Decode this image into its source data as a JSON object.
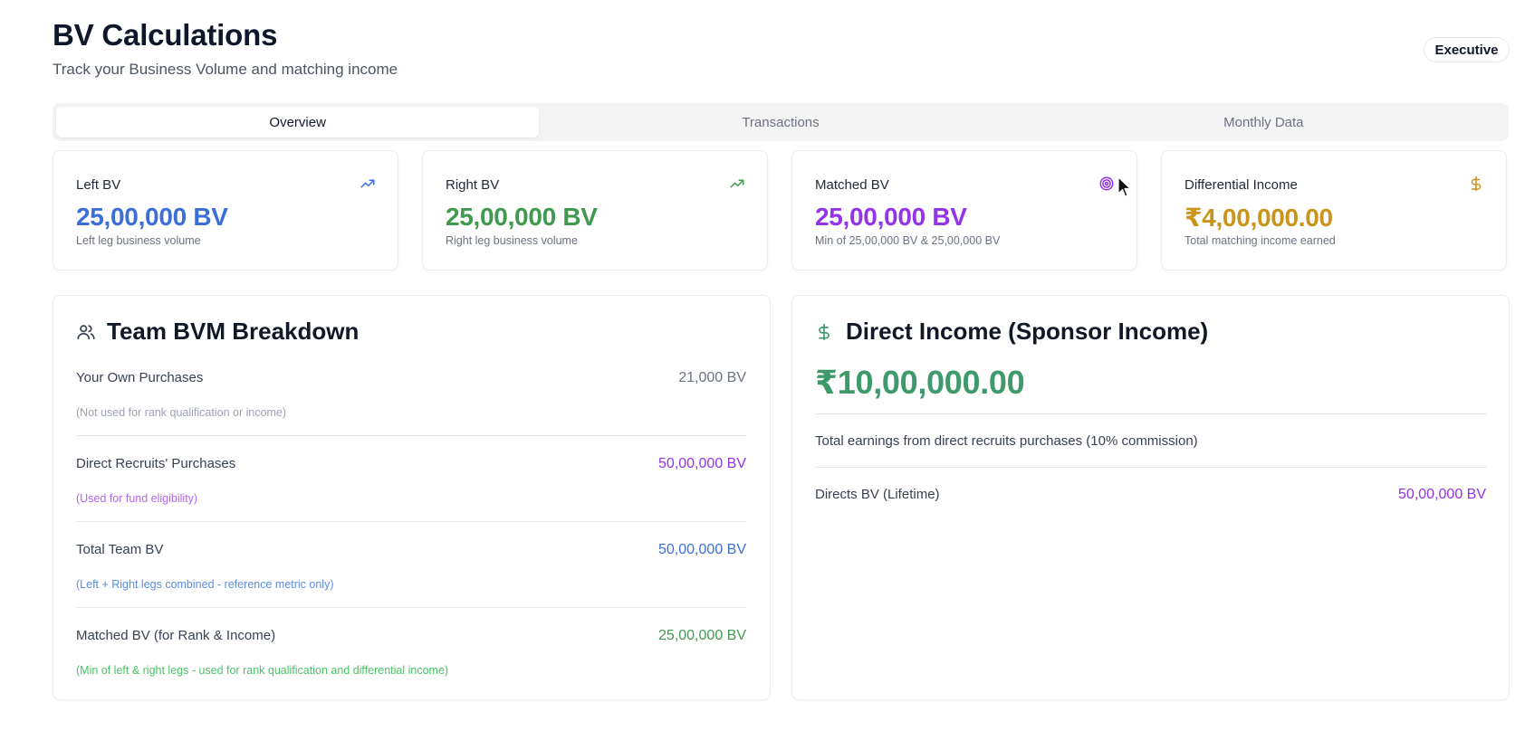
{
  "header": {
    "title": "BV Calculations",
    "subtitle": "Track your Business Volume and matching income",
    "rank_badge": "Executive"
  },
  "tabs": [
    {
      "label": "Overview",
      "active": true
    },
    {
      "label": "Transactions",
      "active": false
    },
    {
      "label": "Monthly Data",
      "active": false
    }
  ],
  "stats": [
    {
      "label": "Left BV",
      "value": "25,00,000 BV",
      "desc": "Left leg business volume",
      "icon": "trending-up-icon",
      "color": "#3b6fd8"
    },
    {
      "label": "Right BV",
      "value": "25,00,000 BV",
      "desc": "Right leg business volume",
      "icon": "trending-up-icon",
      "color": "#3f9a4f"
    },
    {
      "label": "Matched BV",
      "value": "25,00,000 BV",
      "desc": "Min of 25,00,000 BV & 25,00,000 BV",
      "icon": "target-icon",
      "color": "#9333ea"
    },
    {
      "label": "Differential Income",
      "value": "₹4,00,000.00",
      "desc": "Total matching income earned",
      "icon": "dollar-icon",
      "color": "#c99419"
    }
  ],
  "team_breakdown": {
    "title": "Team BVM Breakdown",
    "rows": [
      {
        "label": "Your Own Purchases",
        "value": "21,000 BV",
        "note": "(Not used for rank qualification or income)",
        "value_color": "#6b7280",
        "note_color": "#9ca3af"
      },
      {
        "label": "Direct Recruits' Purchases",
        "value": "50,00,000 BV",
        "note": "(Used for fund eligibility)",
        "value_color": "#9333ea",
        "note_color": "#b266e8"
      },
      {
        "label": "Total Team BV",
        "value": "50,00,000 BV",
        "note": "(Left + Right legs combined - reference metric only)",
        "value_color": "#3b6fd8",
        "note_color": "#5b8de0"
      },
      {
        "label": "Matched BV (for Rank & Income)",
        "value": "25,00,000 BV",
        "note": "(Min of left & right legs - used for rank qualification and differential income)",
        "value_color": "#3f9a4f",
        "note_color": "#4cc26a"
      }
    ]
  },
  "direct_income": {
    "title": "Direct Income (Sponsor Income)",
    "value": "₹10,00,000.00",
    "desc": "Total earnings from direct recruits purchases (10% commission)",
    "directs_label": "Directs BV (Lifetime)",
    "directs_value": "50,00,000 BV"
  }
}
